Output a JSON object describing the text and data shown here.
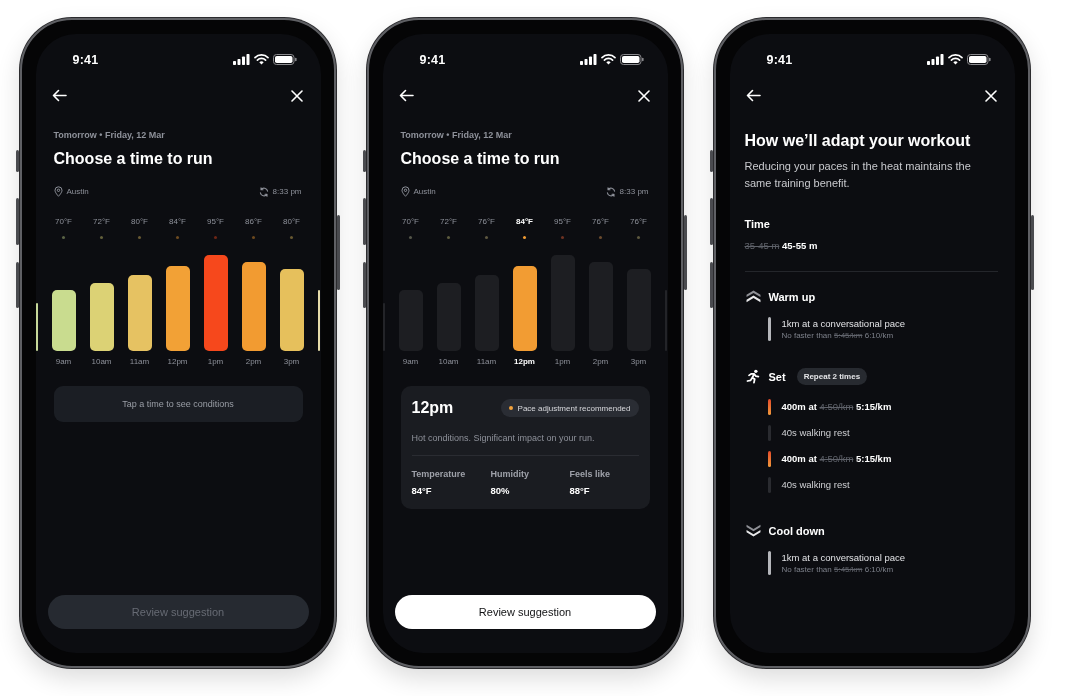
{
  "phones": [
    {
      "kind": "time_picker",
      "status_time": "9:41",
      "date_line": "Tomorrow • Friday, 12 Mar",
      "title": "Choose a time to run",
      "location": "Austin",
      "updated": "8:33 pm",
      "slots": [
        {
          "time": "9am",
          "temp": "70°F",
          "level": 0.61,
          "color": "#c9dc8f",
          "selected": false
        },
        {
          "time": "10am",
          "temp": "72°F",
          "level": 0.68,
          "color": "#dcd275",
          "selected": false
        },
        {
          "time": "11am",
          "temp": "80°F",
          "level": 0.76,
          "color": "#e6c262",
          "selected": false
        },
        {
          "time": "12pm",
          "temp": "84°F",
          "level": 0.85,
          "color": "#f2a136",
          "selected": false
        },
        {
          "time": "1pm",
          "temp": "95°F",
          "level": 0.96,
          "color": "#f6481c",
          "selected": false
        },
        {
          "time": "2pm",
          "temp": "86°F",
          "level": 0.89,
          "color": "#f29b31",
          "selected": false
        },
        {
          "time": "3pm",
          "temp": "80°F",
          "level": 0.82,
          "color": "#e6c05c",
          "selected": false
        }
      ],
      "hint": "Tap a time to see conditions",
      "action": {
        "label": "Review suggestion",
        "disabled": true
      }
    },
    {
      "kind": "time_picker",
      "status_time": "9:41",
      "date_line": "Tomorrow • Friday, 12 Mar",
      "title": "Choose a time to run",
      "location": "Austin",
      "updated": "8:33 pm",
      "slots": [
        {
          "time": "9am",
          "temp": "70°F",
          "level": 0.61,
          "color": "#55564a",
          "selected": false
        },
        {
          "time": "10am",
          "temp": "72°F",
          "level": 0.68,
          "color": "#5c5a3e",
          "selected": false
        },
        {
          "time": "11am",
          "temp": "76°F",
          "level": 0.76,
          "color": "#5e5740",
          "selected": false
        },
        {
          "time": "12pm",
          "temp": "84°F",
          "level": 0.85,
          "color": "#f29c33",
          "selected": true
        },
        {
          "time": "1pm",
          "temp": "95°F",
          "level": 0.96,
          "color": "#6e3222",
          "selected": false
        },
        {
          "time": "2pm",
          "temp": "76°F",
          "level": 0.89,
          "color": "#6b4b2e",
          "selected": false
        },
        {
          "time": "3pm",
          "temp": "76°F",
          "level": 0.82,
          "color": "#5c573e",
          "selected": false
        }
      ],
      "details": {
        "time": "12pm",
        "badge": "Pace adjustment recommended",
        "summary": "Hot conditions. Significant impact on your run.",
        "stats": [
          {
            "label": "Temperature",
            "value": "84°F"
          },
          {
            "label": "Humidity",
            "value": "80%"
          },
          {
            "label": "Feels like",
            "value": "88°F"
          }
        ]
      },
      "action": {
        "label": "Review suggestion",
        "disabled": false
      }
    },
    {
      "kind": "workout",
      "status_time": "9:41",
      "title": "How we’ll adapt your workout",
      "subtitle": "Reducing your paces in the heat maintains the same training benefit.",
      "time": {
        "label": "Time",
        "old": "35-45 m",
        "new": "45-55 m"
      },
      "sections": [
        {
          "kind": "warmup",
          "title": "Warm up",
          "steps": [
            {
              "kind": "easy",
              "text": "1km at a conversational pace",
              "detail": {
                "prefix": "No faster than",
                "old": "5:45/km",
                "new": "6:10/km"
              }
            }
          ]
        },
        {
          "kind": "set",
          "title": "Set",
          "badge": "Repeat 2 times",
          "steps": [
            {
              "kind": "run",
              "pace": {
                "prefix": "400m at",
                "old": "4:50/km",
                "new": "5:15/km"
              }
            },
            {
              "kind": "rest",
              "text": "40s walking rest"
            },
            {
              "kind": "run",
              "pace": {
                "prefix": "400m at",
                "old": "4:50/km",
                "new": "5:15/km"
              }
            },
            {
              "kind": "rest",
              "text": "40s walking rest"
            }
          ]
        },
        {
          "kind": "cooldown",
          "title": "Cool down",
          "steps": [
            {
              "kind": "easy",
              "text": "1km at a conversational pace",
              "detail": {
                "prefix": "No faster than",
                "old": "5:45/km",
                "new": "6:10/km"
              }
            }
          ]
        }
      ]
    }
  ]
}
